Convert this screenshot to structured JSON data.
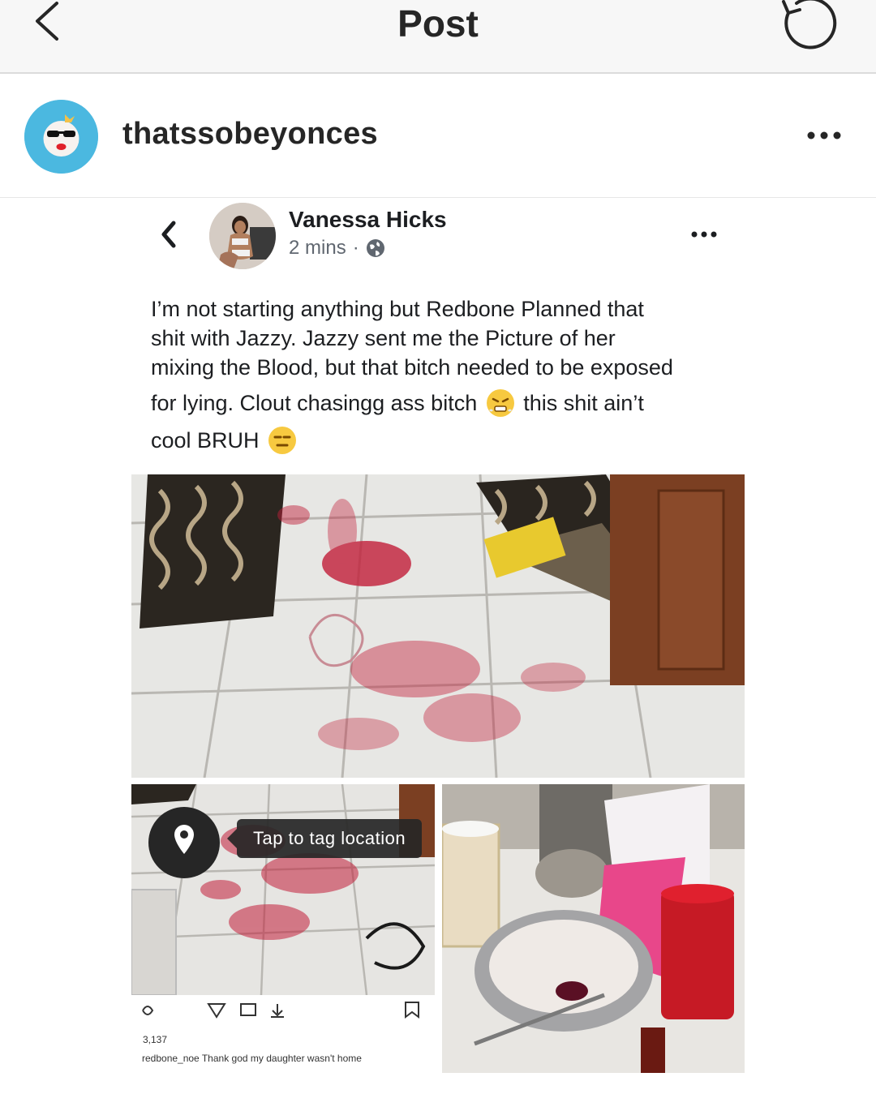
{
  "header": {
    "title": "Post"
  },
  "author": {
    "username": "thatssobeyonces"
  },
  "embedded_post": {
    "name": "Vanessa Hicks",
    "time": "2 mins",
    "separator": "·",
    "text_lines": [
      "I’m not starting anything but Redbone Planned that",
      "shit with Jazzy. Jazzy sent me the Picture of her",
      "mixing the Blood, but that bitch needed to be exposed",
      "for lying. Clout chasingg ass bitch",
      "this shit ain’t",
      "cool BRUH"
    ],
    "inner_screenshot": {
      "count": "3,137",
      "caption": "redbone_noe Thank god my daughter wasn't home"
    }
  },
  "overlay": {
    "tag_location_label": "Tap to tag location"
  },
  "colors": {
    "avatar_bg": "#4bb8e0",
    "header_bg": "#f7f7f7",
    "tooltip_bg": "#262626"
  }
}
